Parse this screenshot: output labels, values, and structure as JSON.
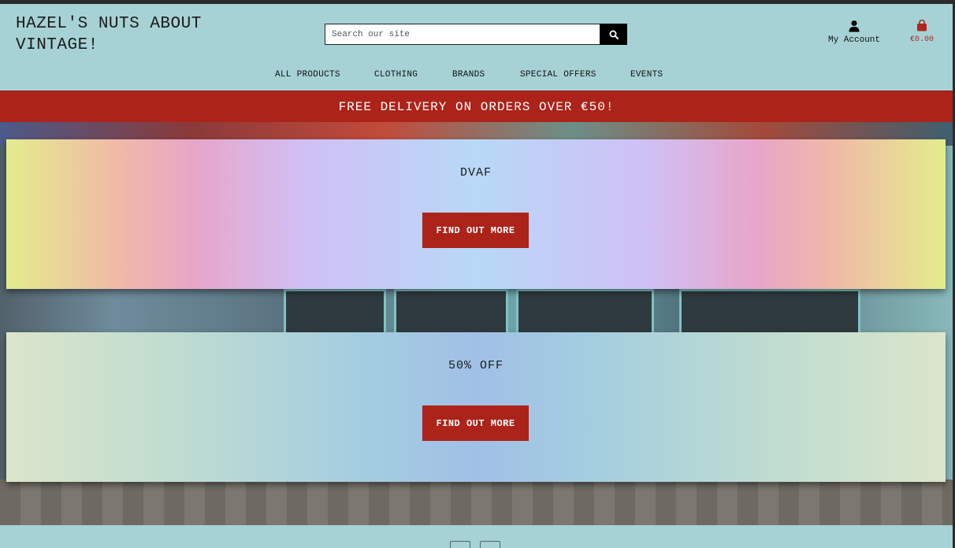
{
  "header": {
    "logo": "HAZEL'S NUTS ABOUT VINTAGE!",
    "search_placeholder": "Search our site",
    "search_icon": "search-icon",
    "account_label": "My Account",
    "account_icon": "user-icon",
    "bag_total": "€0.00",
    "bag_icon": "shopping-bag-icon"
  },
  "nav": {
    "items": [
      {
        "label": "ALL PRODUCTS"
      },
      {
        "label": "CLOTHING"
      },
      {
        "label": "BRANDS"
      },
      {
        "label": "SPECIAL OFFERS"
      },
      {
        "label": "EVENTS"
      }
    ]
  },
  "banner": {
    "text": "FREE DELIVERY ON ORDERS OVER €50!"
  },
  "promos": [
    {
      "title": "DVAF",
      "button_label": "FIND OUT MORE"
    },
    {
      "title": "50% OFF",
      "button_label": "FIND OUT MORE"
    }
  ],
  "colors": {
    "accent_red": "#ac2319",
    "header_bg": "#a6d2d5"
  }
}
